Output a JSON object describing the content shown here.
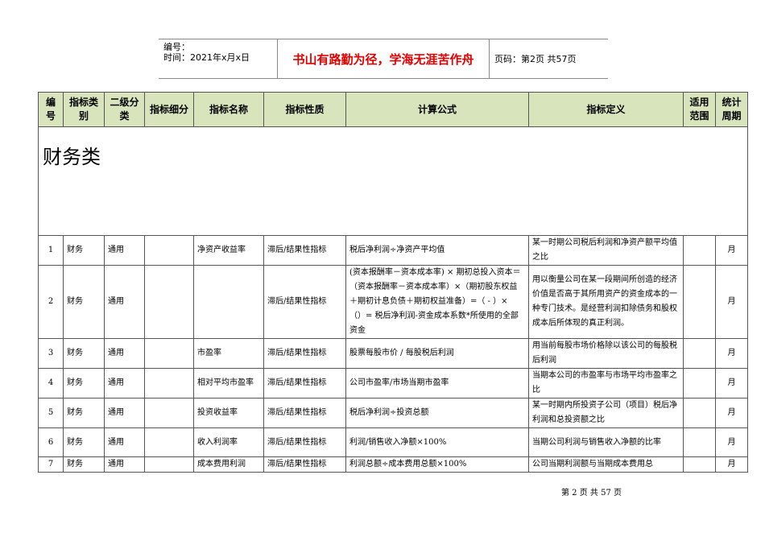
{
  "header": {
    "number_label": "编号：",
    "date_label": "时间：2021年x月x日",
    "motto": "书山有路勤为径，学海无涯苦作舟",
    "page_label": "页码：第2页 共57页"
  },
  "table": {
    "columns": [
      "编号",
      "指标类别",
      "二级分类",
      "指标细分",
      "指标名称",
      "指标性质",
      "计算公式",
      "指标定义",
      "适用范围",
      "统计周期"
    ],
    "category": "财务类",
    "rows": [
      {
        "no": "1",
        "type": "财务",
        "sub": "通用",
        "detail": "",
        "name": "净资产收益率",
        "nature": "滞后/结果性指标",
        "formula": "税后净利润÷净资产平均值",
        "definition": "某一时期公司税后利润和净资产额平均值之比",
        "scope": "",
        "period": "月"
      },
      {
        "no": "2",
        "type": "财务",
        "sub": "通用",
        "detail": "",
        "name": "",
        "nature": "滞后/结果性指标",
        "formula": "(资本报酬率－资本成本率) × 期初总投入资本＝（资本报酬率－资本成本率）×（期初股东权益＋期初计息负债＋期初权益准备）=（ - ）×　　（）= 税后净利润-资金成本系数*所使用的全部资金",
        "definition": "用以衡量公司在某一段期间所创造的经济价值是否高于其所用资产的资金成本的一种专门技术。是经营利润扣除债务和股权成本后所体现的真正利润。",
        "scope": "",
        "period": "月"
      },
      {
        "no": "3",
        "type": "财务",
        "sub": "通用",
        "detail": "",
        "name": "市盈率",
        "nature": "滞后/结果性指标",
        "formula": "股票每股市价 / 每股税后利润",
        "definition": "用当前每股市场价格除以该公司的每股税后利润",
        "scope": "",
        "period": "月"
      },
      {
        "no": "4",
        "type": "财务",
        "sub": "通用",
        "detail": "",
        "name": "相对平均市盈率",
        "nature": "滞后/结果性指标",
        "formula": "公司市盈率/市场当期市盈率",
        "definition": "当期本公司的市盈率与市场平均市盈率之比",
        "scope": "",
        "period": "月"
      },
      {
        "no": "5",
        "type": "财务",
        "sub": "通用",
        "detail": "",
        "name": "投资收益率",
        "nature": "滞后/结果性指标",
        "formula": "税后净利润÷投资总额",
        "definition": "某一时期内所投资子公司（项目）税后净利润和总投资额之比",
        "scope": "",
        "period": "月"
      },
      {
        "no": "6",
        "type": "财务",
        "sub": "通用",
        "detail": "",
        "name": "收入利润率",
        "nature": "滞后/结果性指标",
        "formula": "利润/销售收入净额×100%",
        "definition": "当期公司利润与销售收入净额的比率",
        "scope": "",
        "period": "月"
      },
      {
        "no": "7",
        "type": "财务",
        "sub": "通用",
        "detail": "",
        "name": "成本费用利润",
        "nature": "滞后/结果性指标",
        "formula": "利润总额÷成本费用总额×100%",
        "definition": "公司当期利润额与当期成本费用总",
        "scope": "",
        "period": "月"
      }
    ]
  },
  "footer": "第 2 页 共 57 页"
}
